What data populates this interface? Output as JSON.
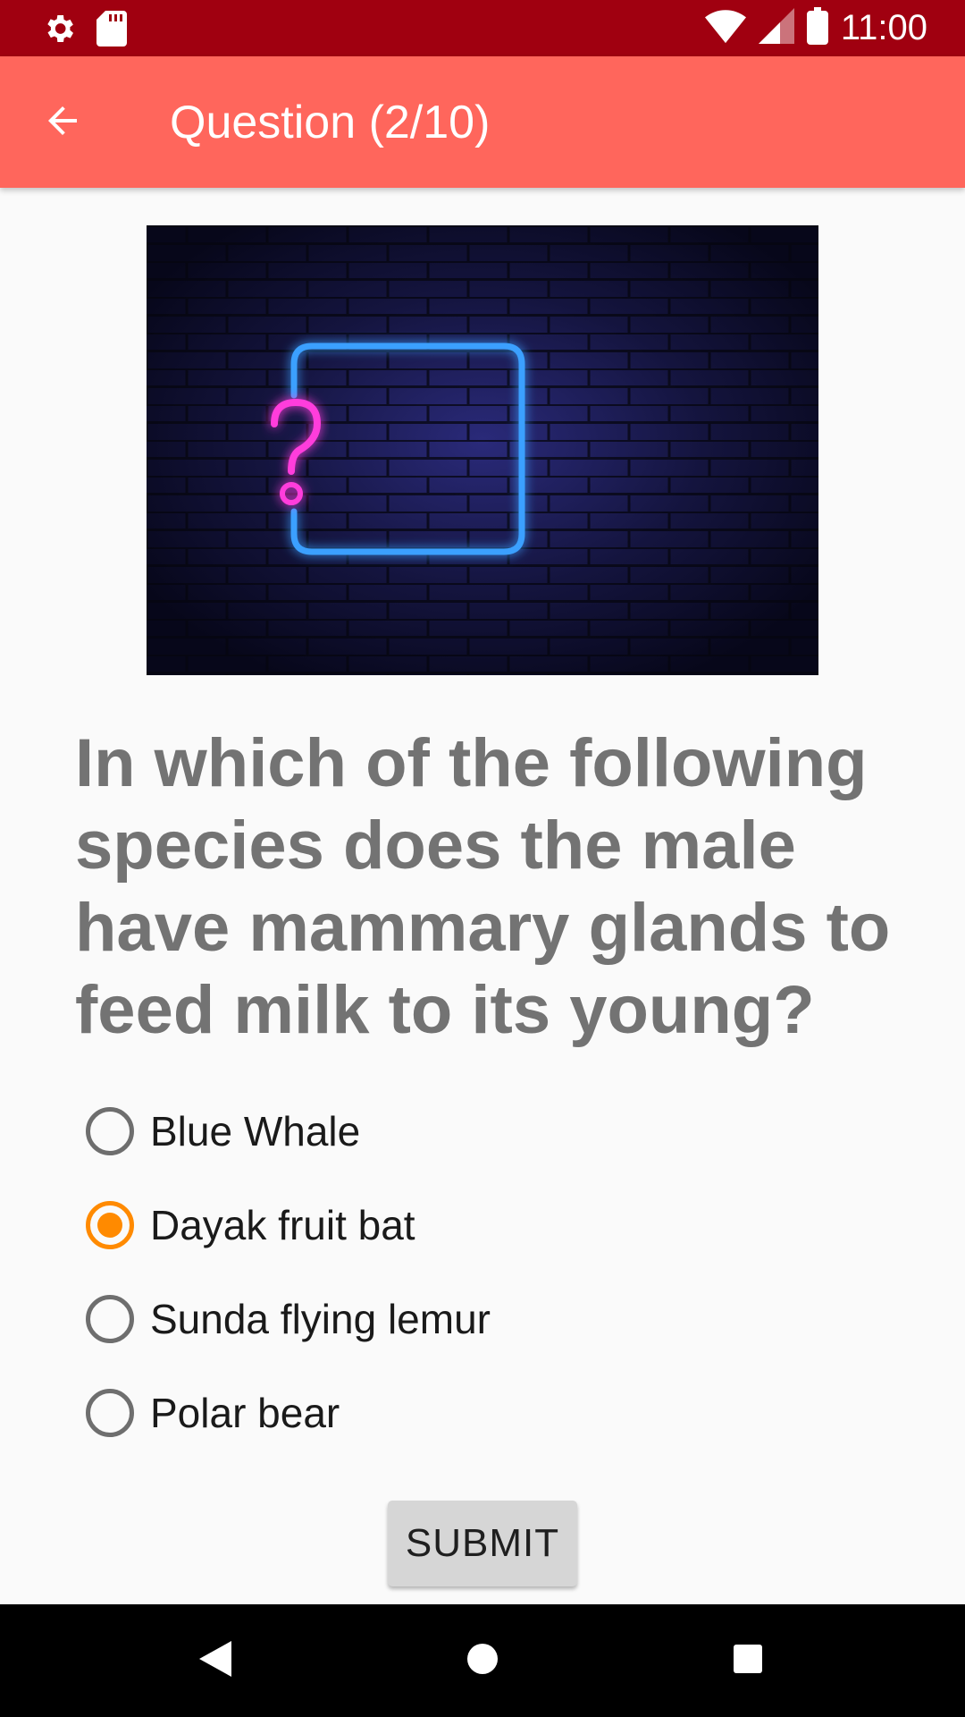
{
  "status_bar": {
    "time": "11:00",
    "icons": [
      "settings-icon",
      "sd-card-icon",
      "wifi-icon",
      "signal-icon",
      "battery-icon"
    ]
  },
  "app_bar": {
    "title": "Question (2/10)",
    "back_icon": "arrow-back-icon"
  },
  "quiz": {
    "question": "In which of the following species does the male have mammary glands to feed milk to its young?",
    "options": [
      {
        "label": "Blue Whale",
        "selected": false
      },
      {
        "label": "Dayak fruit bat",
        "selected": true
      },
      {
        "label": "Sunda flying lemur",
        "selected": false
      },
      {
        "label": "Polar bear",
        "selected": false
      }
    ],
    "submit_label": "SUBMIT"
  },
  "nav_bar": {
    "icons": [
      "back-triangle-icon",
      "home-circle-icon",
      "recents-square-icon"
    ]
  },
  "colors": {
    "status_bar": "#a00010",
    "app_bar": "#ff665c",
    "accent": "#ff8a00",
    "question_text": "#737373",
    "neon_blue": "#3aa0ff",
    "neon_pink": "#ff3ddc"
  }
}
